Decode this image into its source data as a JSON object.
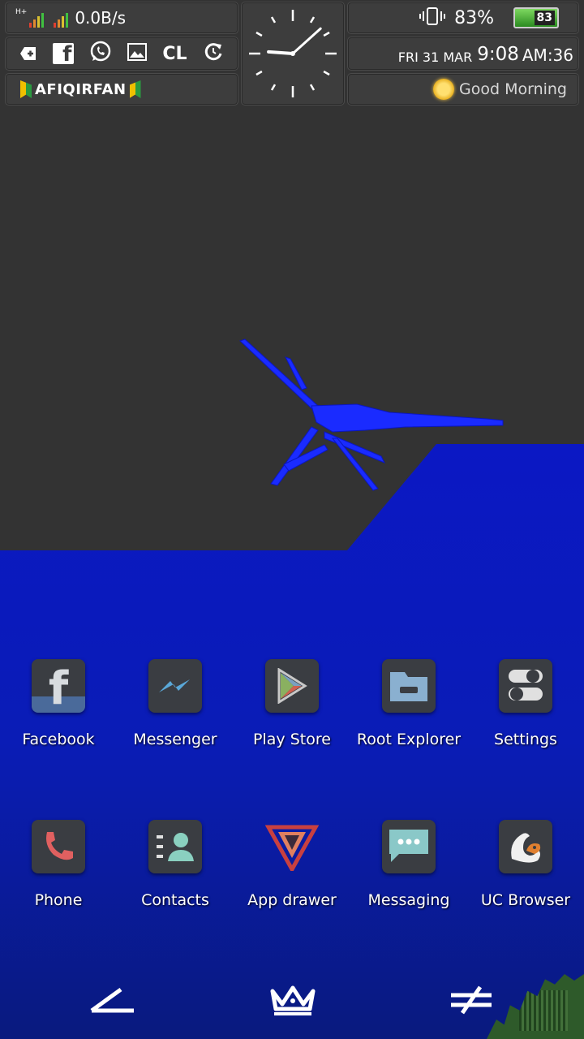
{
  "status": {
    "network_type": "H+",
    "net_speed": "0.0B/s",
    "battery_percent": "83%",
    "battery_level": "83",
    "date": "FRI 31 MAR",
    "time": "9:08",
    "ampm_seconds": "AM:36",
    "greeting": "Good Morning",
    "username": "AFIQIRFAN"
  },
  "clock": {
    "hour": 9,
    "minute": 8
  },
  "shortcuts": [
    {
      "name": "add-icon"
    },
    {
      "name": "facebook-icon"
    },
    {
      "name": "whatsapp-icon"
    },
    {
      "name": "gallery-icon"
    },
    {
      "name": "cl-icon",
      "label": "CL"
    },
    {
      "name": "refresh-icon"
    }
  ],
  "apps_row1": [
    {
      "label": "Facebook",
      "icon": "facebook-icon"
    },
    {
      "label": "Messenger",
      "icon": "messenger-icon"
    },
    {
      "label": "Play Store",
      "icon": "play-store-icon"
    },
    {
      "label": "Root Explorer",
      "icon": "folder-icon"
    },
    {
      "label": "Settings",
      "icon": "toggle-settings-icon"
    }
  ],
  "apps_row2": [
    {
      "label": "Phone",
      "icon": "phone-icon"
    },
    {
      "label": "Contacts",
      "icon": "contacts-icon"
    },
    {
      "label": "App drawer",
      "icon": "app-drawer-icon"
    },
    {
      "label": "Messaging",
      "icon": "chat-bubble-icon"
    },
    {
      "label": "UC Browser",
      "icon": "uc-browser-icon"
    }
  ],
  "dock": [
    {
      "icon": "angle-icon"
    },
    {
      "icon": "crown-icon"
    },
    {
      "icon": "not-equal-icon"
    }
  ],
  "colors": {
    "accent_blue": "#0a1fc8",
    "panel": "#3d3d3d",
    "background": "#333333"
  }
}
